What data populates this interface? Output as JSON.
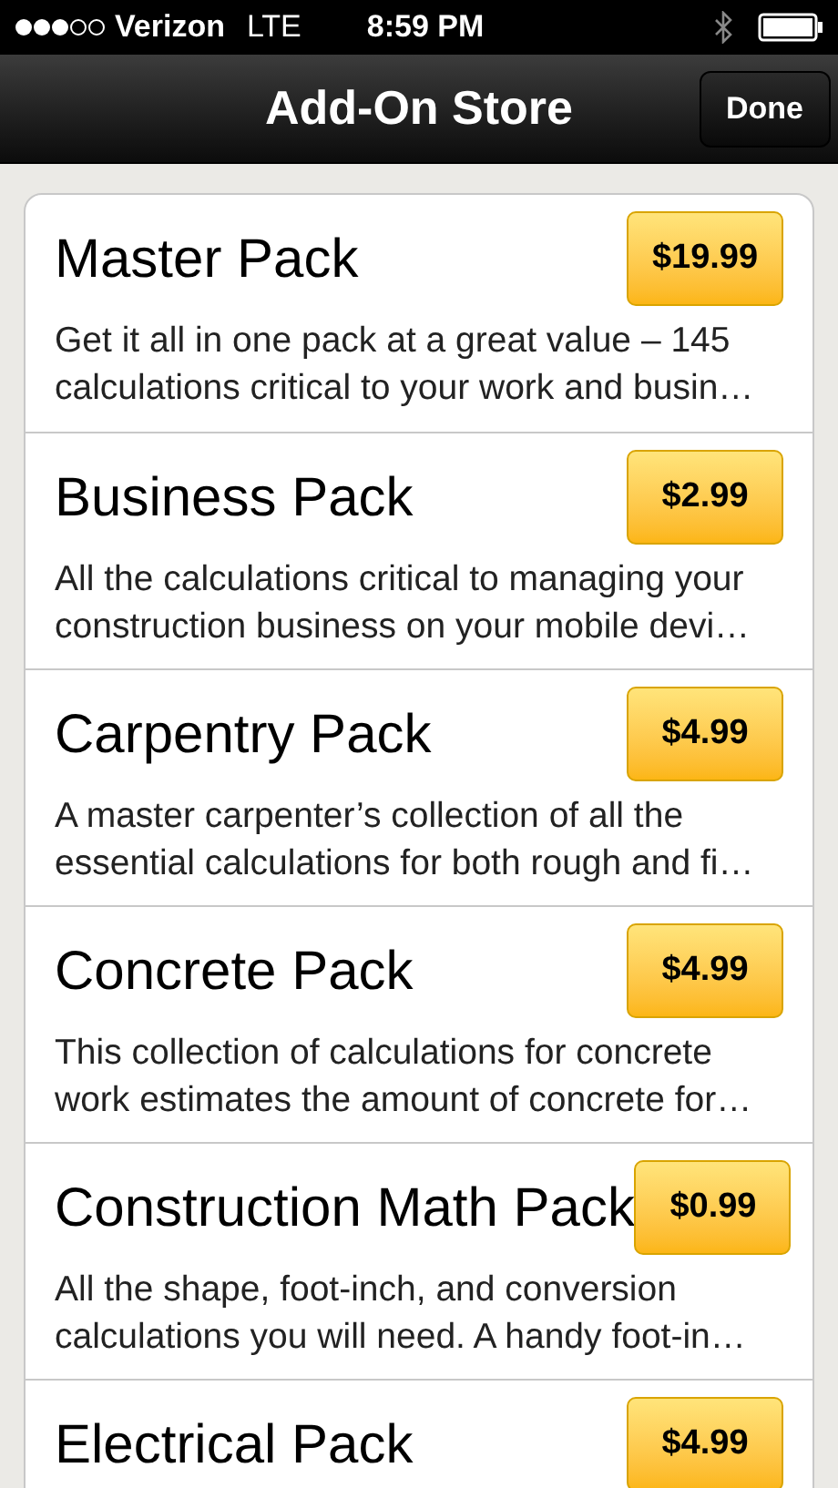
{
  "status_bar": {
    "carrier": "Verizon",
    "network": "LTE",
    "time": "8:59 PM"
  },
  "nav_bar": {
    "title": "Add-On Store",
    "done_button": "Done"
  },
  "packs": [
    {
      "name": "Master Pack",
      "price": "$19.99",
      "description": "Get it all in one pack at a great value – 145\ncalculations critical to your work and busin…"
    },
    {
      "name": "Business Pack",
      "price": "$2.99",
      "description": "All the calculations critical to managing your\nconstruction business on your mobile devi…"
    },
    {
      "name": "Carpentry Pack",
      "price": "$4.99",
      "description": "A master carpenter’s collection of all the\nessential calculations for both rough and fi…"
    },
    {
      "name": "Concrete Pack",
      "price": "$4.99",
      "description": "This collection of calculations for concrete\nwork estimates the amount of concrete for…"
    },
    {
      "name": "Construction Math Pack",
      "price": "$0.99",
      "description": "All the shape, foot-inch, and conversion\ncalculations you will need. A handy foot-in…"
    },
    {
      "name": "Electrical Pack",
      "price": "$4.99"
    }
  ]
}
